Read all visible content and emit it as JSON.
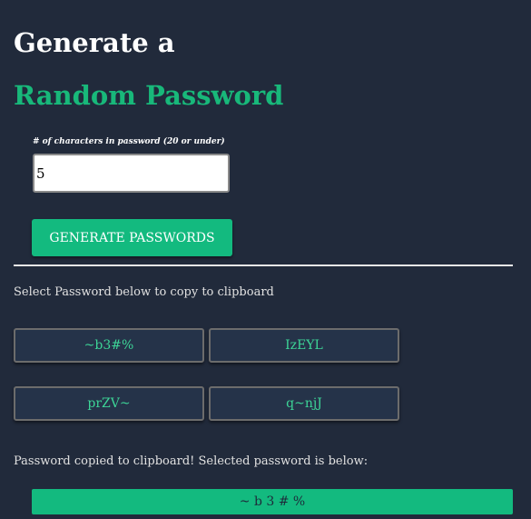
{
  "header": {
    "title_line1": "Generate a",
    "title_line2": "Random Password"
  },
  "form": {
    "length_label": "# of characters in password (20 or under)",
    "length_value": "5",
    "generate_label": "GENERATE PASSWORDS"
  },
  "results": {
    "instruction": "Select Password below to copy to clipboard",
    "passwords": [
      "~b3#%",
      "IzEYL",
      "prZV~",
      "q~njJ"
    ],
    "copied_message": "Password copied to clipboard! Selected password is below:",
    "selected_password": "~ b 3 # %"
  },
  "colors": {
    "background": "#212a3b",
    "accent_green": "#13ba7f",
    "password_text": "#3dd597",
    "password_button_bg": "#253349"
  }
}
